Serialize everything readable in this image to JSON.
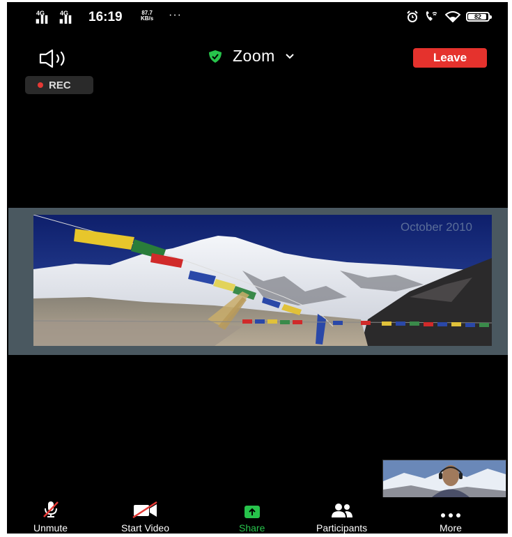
{
  "status_bar": {
    "signal_1": "4G",
    "signal_2": "4G",
    "time": "16:19",
    "speed_value": "87.7",
    "speed_unit": "KB/s",
    "more_dots": "···",
    "battery": "82"
  },
  "top_bar": {
    "title": "Zoom",
    "leave_label": "Leave",
    "rec_label": "REC"
  },
  "shared_screen": {
    "caption": "October 2010"
  },
  "toolbar": {
    "unmute": "Unmute",
    "start_video": "Start Video",
    "share": "Share",
    "participants": "Participants",
    "more": "More"
  },
  "colors": {
    "leave": "#e5322d",
    "share_accent": "#27c34b",
    "shield": "#27c34b"
  },
  "icons": [
    "speaker-icon",
    "shield-icon",
    "chevron-down-icon",
    "mic-muted-icon",
    "video-off-icon",
    "share-arrow-icon",
    "participants-icon",
    "more-dots-icon",
    "alarm-icon",
    "wifi-calling-icon",
    "wifi-icon",
    "battery-icon"
  ]
}
